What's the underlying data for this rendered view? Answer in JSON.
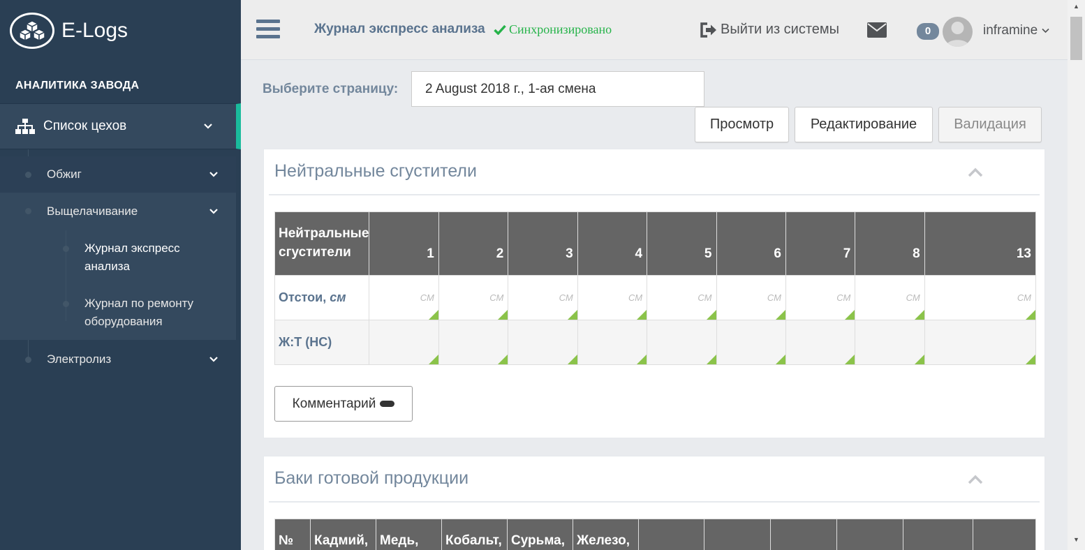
{
  "brand": {
    "name": "E-Logs"
  },
  "sidebar": {
    "section_title": "АНАЛИТИКА ЗАВОДА",
    "top_item": "Список цехов",
    "items": [
      {
        "label": "Обжиг"
      },
      {
        "label": "Выщелачивание"
      },
      {
        "label": "Электролиз"
      }
    ],
    "leaves": [
      {
        "label": "Журнал экспресс анализа"
      },
      {
        "label": "Журнал по ремонту оборудования"
      }
    ]
  },
  "topnav": {
    "journal_title": "Журнал экспресс анализа",
    "sync_status": "Синхронизировано",
    "logout": "Выйти из системы",
    "notification_count": "0",
    "username": "inframine"
  },
  "page_select": {
    "label": "Выберите страницу:",
    "value": "2 August 2018 г., 1-ая смена"
  },
  "mode_buttons": {
    "view": "Просмотр",
    "edit": "Редактирование",
    "validate": "Валидация"
  },
  "panel1": {
    "title": "Нейтральные сгустители",
    "table": {
      "corner_header": "Нейтральные сгустители",
      "columns": [
        "1",
        "2",
        "3",
        "4",
        "5",
        "6",
        "7",
        "8",
        "13"
      ],
      "row1_label": "Отстои,",
      "row1_unit_label": "см",
      "cell_unit": "СМ",
      "row2_label": "Ж:Т (НС)"
    },
    "comment_button": "Комментарий"
  },
  "panel2": {
    "title": "Баки готовой продукции",
    "columns": [
      "№",
      "Кадмий,",
      "Медь,",
      "Кобальт,",
      "Сурьма,",
      "Железо,",
      "",
      "",
      "",
      "",
      "",
      ""
    ]
  },
  "colors": {
    "sidebar_bg": "#2a3f54",
    "accent": "#1abb9c",
    "table_header_bg": "#656565",
    "sync_green": "#26b34a",
    "edit_corner": "#8bc34a"
  }
}
